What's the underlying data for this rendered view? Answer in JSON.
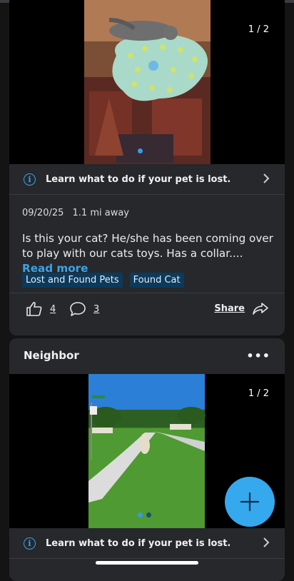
{
  "post1": {
    "photo_counter": "1 / 2",
    "lost_pet_link": "Learn what to do if your pet is lost.",
    "date": "09/20/25",
    "distance": "1.1 mi away",
    "text": "Is this your cat?   He/she has been coming over to play with our cats toys.  Has a collar....",
    "read_more": "Read more",
    "tags": [
      "Lost and Found Pets",
      "Found Cat"
    ],
    "like_count": "4",
    "comment_count": "3",
    "share_label": "Share"
  },
  "post2": {
    "author": "Neighbor",
    "photo_counter": "1 / 2",
    "lost_pet_link": "Learn what to do if your pet is lost."
  },
  "icons": {
    "info": "info-icon",
    "chevron": "chevron-right-icon",
    "like": "thumbs-up-icon",
    "comment": "comment-icon",
    "share": "share-arrow-icon",
    "more": "more-horizontal-icon",
    "fab": "plus-icon"
  },
  "colors": {
    "accent": "#35a8ee",
    "card": "#26282b",
    "tag_bg": "#0b3a5c"
  }
}
